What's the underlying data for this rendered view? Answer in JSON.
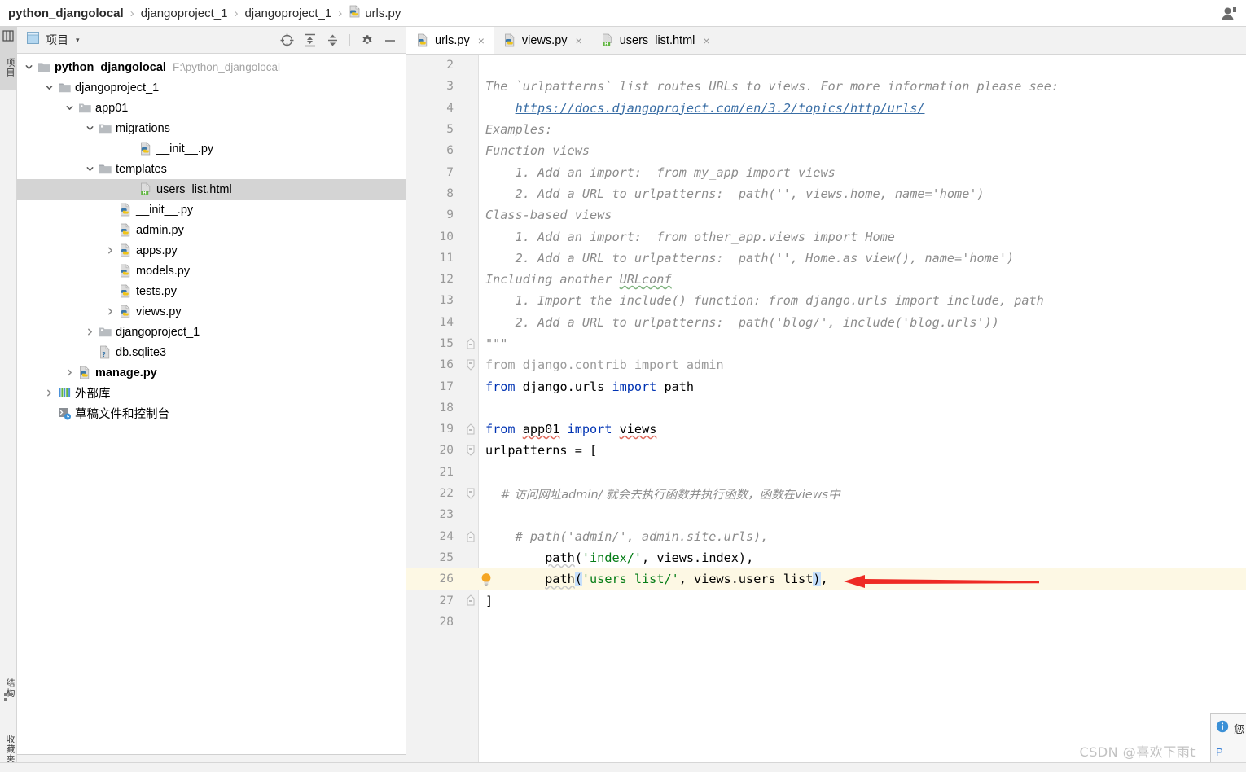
{
  "breadcrumb": {
    "items": [
      {
        "label": "python_djangolocal",
        "bold": true,
        "icon": null
      },
      {
        "label": "djangoproject_1",
        "bold": false,
        "icon": null
      },
      {
        "label": "djangoproject_1",
        "bold": false,
        "icon": null
      },
      {
        "label": "urls.py",
        "bold": false,
        "icon": "python-file-icon"
      }
    ],
    "separator": "›",
    "user_icon": "user-account-icon"
  },
  "tool_strip": {
    "top_tab": {
      "label": "项目",
      "icon": "project-structure-icon"
    },
    "bottom_tabs": [
      {
        "label": "结构",
        "icon": "structure-icon"
      },
      {
        "label": "收藏夹",
        "icon": "favorites-star-icon"
      }
    ]
  },
  "project_panel": {
    "title": "项目",
    "caret": "▾",
    "tools": [
      {
        "name": "locate-target-icon",
        "title": "Select Opened File"
      },
      {
        "name": "expand-all-icon",
        "title": "Expand All"
      },
      {
        "name": "collapse-all-icon",
        "title": "Collapse All"
      },
      {
        "name": "settings-gear-icon",
        "title": "Settings"
      },
      {
        "name": "hide-panel-icon",
        "title": "Hide"
      }
    ],
    "tree": [
      {
        "label": "python_djangolocal",
        "path": "F:\\python_djangolocal",
        "indent": 0,
        "twist": "down",
        "icon": "folder-icon",
        "bold": true,
        "selected": false
      },
      {
        "label": "djangoproject_1",
        "path": "",
        "indent": 1,
        "twist": "down",
        "icon": "folder-icon",
        "bold": false,
        "selected": false
      },
      {
        "label": "app01",
        "path": "",
        "indent": 2,
        "twist": "down",
        "icon": "module-folder-icon",
        "bold": false,
        "selected": false
      },
      {
        "label": "migrations",
        "path": "",
        "indent": 3,
        "twist": "down",
        "icon": "module-folder-icon",
        "bold": false,
        "selected": false
      },
      {
        "label": "__init__.py",
        "path": "",
        "indent": 5,
        "twist": "none",
        "icon": "python-file-icon",
        "bold": false,
        "selected": false
      },
      {
        "label": "templates",
        "path": "",
        "indent": 3,
        "twist": "down",
        "icon": "folder-icon",
        "bold": false,
        "selected": false
      },
      {
        "label": "users_list.html",
        "path": "",
        "indent": 5,
        "twist": "none",
        "icon": "html-file-icon",
        "bold": false,
        "selected": true
      },
      {
        "label": "__init__.py",
        "path": "",
        "indent": 4,
        "twist": "none",
        "icon": "python-file-icon",
        "bold": false,
        "selected": false
      },
      {
        "label": "admin.py",
        "path": "",
        "indent": 4,
        "twist": "none",
        "icon": "python-file-icon",
        "bold": false,
        "selected": false
      },
      {
        "label": "apps.py",
        "path": "",
        "indent": 4,
        "twist": "right",
        "icon": "python-file-icon",
        "bold": false,
        "selected": false
      },
      {
        "label": "models.py",
        "path": "",
        "indent": 4,
        "twist": "none",
        "icon": "python-file-icon",
        "bold": false,
        "selected": false
      },
      {
        "label": "tests.py",
        "path": "",
        "indent": 4,
        "twist": "none",
        "icon": "python-file-icon",
        "bold": false,
        "selected": false
      },
      {
        "label": "views.py",
        "path": "",
        "indent": 4,
        "twist": "right",
        "icon": "python-file-icon",
        "bold": false,
        "selected": false
      },
      {
        "label": "djangoproject_1",
        "path": "",
        "indent": 3,
        "twist": "right",
        "icon": "module-folder-icon",
        "bold": false,
        "selected": false
      },
      {
        "label": "db.sqlite3",
        "path": "",
        "indent": 3,
        "twist": "none",
        "icon": "unknown-file-icon",
        "bold": false,
        "selected": false
      },
      {
        "label": "manage.py",
        "path": "",
        "indent": 2,
        "twist": "right",
        "icon": "python-file-icon",
        "bold": true,
        "selected": false
      },
      {
        "label": "外部库",
        "path": "",
        "indent": 1,
        "twist": "right",
        "icon": "library-icon",
        "bold": false,
        "selected": false
      },
      {
        "label": "草稿文件和控制台",
        "path": "",
        "indent": 1,
        "twist": "none",
        "icon": "scratches-console-icon",
        "bold": false,
        "selected": false
      }
    ]
  },
  "editor": {
    "tabs": [
      {
        "label": "urls.py",
        "icon": "python-file-icon",
        "active": true,
        "close": "×"
      },
      {
        "label": "views.py",
        "icon": "python-file-icon",
        "active": false,
        "close": "×"
      },
      {
        "label": "users_list.html",
        "icon": "html-file-icon",
        "active": false,
        "close": "×"
      }
    ],
    "highlighted_line": 26,
    "lines": [
      {
        "n": 2,
        "fold": "none",
        "bulb": false,
        "parts": []
      },
      {
        "n": 3,
        "fold": "none",
        "bulb": false,
        "parts": [
          {
            "t": "The `urlpatterns` list routes URLs to views. For more information please see:",
            "c": "s-doc"
          }
        ]
      },
      {
        "n": 4,
        "fold": "none",
        "bulb": false,
        "parts": [
          {
            "t": "    ",
            "c": "s-doc"
          },
          {
            "t": "https://docs.djangoproject.com/en/3.2/topics/http/urls/",
            "c": "s-link"
          }
        ]
      },
      {
        "n": 5,
        "fold": "none",
        "bulb": false,
        "parts": [
          {
            "t": "Examples:",
            "c": "s-doc"
          }
        ]
      },
      {
        "n": 6,
        "fold": "none",
        "bulb": false,
        "parts": [
          {
            "t": "Function views",
            "c": "s-doc"
          }
        ]
      },
      {
        "n": 7,
        "fold": "none",
        "bulb": false,
        "parts": [
          {
            "t": "    1. Add an import:  from my_app import views",
            "c": "s-doc"
          }
        ]
      },
      {
        "n": 8,
        "fold": "none",
        "bulb": false,
        "parts": [
          {
            "t": "    2. Add a URL to urlpatterns:  path('', views.home, name='home')",
            "c": "s-doc"
          }
        ]
      },
      {
        "n": 9,
        "fold": "none",
        "bulb": false,
        "parts": [
          {
            "t": "Class-based views",
            "c": "s-doc"
          }
        ]
      },
      {
        "n": 10,
        "fold": "none",
        "bulb": false,
        "parts": [
          {
            "t": "    1. Add an import:  from other_app.views import Home",
            "c": "s-doc"
          }
        ]
      },
      {
        "n": 11,
        "fold": "none",
        "bulb": false,
        "parts": [
          {
            "t": "    2. Add a URL to urlpatterns:  path('', Home.as_view(), name='home')",
            "c": "s-doc"
          }
        ]
      },
      {
        "n": 12,
        "fold": "none",
        "bulb": false,
        "parts": [
          {
            "t": "Including another ",
            "c": "s-doc"
          },
          {
            "t": "URLconf",
            "c": "s-doc squiggle-green"
          }
        ]
      },
      {
        "n": 13,
        "fold": "none",
        "bulb": false,
        "parts": [
          {
            "t": "    1. Import the include() function: from django.urls import include, path",
            "c": "s-doc"
          }
        ]
      },
      {
        "n": 14,
        "fold": "none",
        "bulb": false,
        "parts": [
          {
            "t": "    2. Add a URL to urlpatterns:  path('blog/', include('blog.urls'))",
            "c": "s-doc"
          }
        ]
      },
      {
        "n": 15,
        "fold": "end",
        "bulb": false,
        "parts": [
          {
            "t": "\"\"\"",
            "c": "s-doc"
          }
        ]
      },
      {
        "n": 16,
        "fold": "start",
        "bulb": false,
        "parts": [
          {
            "t": "from django.contrib import admin",
            "c": "s-dim"
          }
        ]
      },
      {
        "n": 17,
        "fold": "none",
        "bulb": false,
        "parts": [
          {
            "t": "from",
            "c": "s-kw"
          },
          {
            "t": " django.urls ",
            "c": "s-plain"
          },
          {
            "t": "import",
            "c": "s-kw"
          },
          {
            "t": " path",
            "c": "s-plain"
          }
        ]
      },
      {
        "n": 18,
        "fold": "none",
        "bulb": false,
        "parts": []
      },
      {
        "n": 19,
        "fold": "end",
        "bulb": false,
        "parts": [
          {
            "t": "from",
            "c": "s-kw"
          },
          {
            "t": " ",
            "c": "s-plain"
          },
          {
            "t": "app01",
            "c": "s-plain squiggle-red"
          },
          {
            "t": " ",
            "c": "s-plain"
          },
          {
            "t": "import",
            "c": "s-kw"
          },
          {
            "t": " ",
            "c": "s-plain"
          },
          {
            "t": "views",
            "c": "s-plain squiggle-red"
          }
        ]
      },
      {
        "n": 20,
        "fold": "start",
        "bulb": false,
        "parts": [
          {
            "t": "urlpatterns = [",
            "c": "s-plain"
          }
        ]
      },
      {
        "n": 21,
        "fold": "none",
        "bulb": false,
        "parts": []
      },
      {
        "n": 22,
        "fold": "start",
        "bulb": false,
        "parts": [
          {
            "t": "    # 访问网址admin/ 就会去执行函数并执行函数，函数在views中",
            "c": "cn-comment"
          }
        ]
      },
      {
        "n": 23,
        "fold": "none",
        "bulb": false,
        "parts": []
      },
      {
        "n": 24,
        "fold": "end",
        "bulb": false,
        "parts": [
          {
            "t": "    # path('admin/', admin.site.urls),",
            "c": "s-comment"
          }
        ]
      },
      {
        "n": 25,
        "fold": "none",
        "bulb": false,
        "parts": [
          {
            "t": "        ",
            "c": "s-plain"
          },
          {
            "t": "path",
            "c": "s-fnname squiggle-gray"
          },
          {
            "t": "(",
            "c": "s-plain"
          },
          {
            "t": "'index/'",
            "c": "s-str"
          },
          {
            "t": ", views.index)",
            "c": "s-plain"
          },
          {
            "t": ",",
            "c": "s-plain"
          }
        ]
      },
      {
        "n": 26,
        "fold": "none",
        "bulb": true,
        "parts": [
          {
            "t": "        ",
            "c": "s-plain"
          },
          {
            "t": "path",
            "c": "s-fnname squiggle-gray"
          },
          {
            "t": "(",
            "c": "s-plain s-brhl"
          },
          {
            "t": "'users_list/'",
            "c": "s-str"
          },
          {
            "t": ", views.users_list",
            "c": "s-plain"
          },
          {
            "t": ")",
            "c": "s-plain s-brhl"
          },
          {
            "t": ",",
            "c": "s-plain"
          }
        ]
      },
      {
        "n": 27,
        "fold": "end",
        "bulb": false,
        "parts": [
          {
            "t": "]",
            "c": "s-plain"
          }
        ]
      },
      {
        "n": 28,
        "fold": "none",
        "bulb": false,
        "parts": []
      }
    ]
  },
  "annotation": {
    "arrow_color": "#ee2a24",
    "arrow_direction": "left"
  },
  "notification": {
    "icon": "info-icon",
    "title": "您",
    "link": "P"
  },
  "watermark": {
    "text": "CSDN @喜欢下雨t"
  },
  "colors": {
    "selection_bg": "#d4d4d4",
    "line_highlight_bg": "#fdf8e4",
    "bracket_highlight_bg": "#c5dffc",
    "keyword": "#0033b3",
    "string": "#067d17",
    "comment": "#8c8c8c",
    "link": "#3a6ea5"
  }
}
